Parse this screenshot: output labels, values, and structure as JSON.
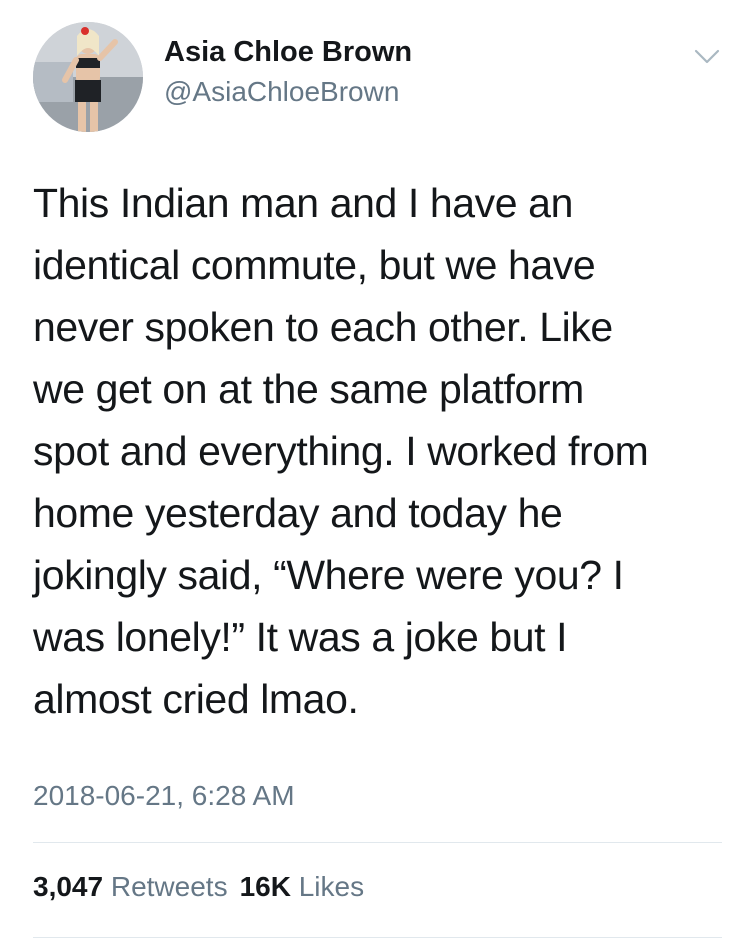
{
  "author": {
    "name": "Asia Chloe Brown",
    "handle": "@AsiaChloeBrown",
    "avatar_icon": "profile-photo"
  },
  "menu": {
    "icon": "chevron-down-icon"
  },
  "tweet": {
    "lines": [
      "This Indian man and I have an",
      "identical commute, but we have",
      "never spoken to each other. Like",
      "we get on at the same platform",
      "spot and everything. I worked from",
      "home yesterday and today he",
      "jokingly said, “Where were you? I",
      "was lonely!” It was a joke but I",
      "almost cried lmao."
    ],
    "timestamp": "2018-06-21, 6:28 AM"
  },
  "stats": {
    "retweets_count": "3,047",
    "retweets_label": "Retweets",
    "likes_count": "16K",
    "likes_label": "Likes"
  },
  "colors": {
    "text": "#14171a",
    "secondary": "#657786",
    "divider": "#e1e8ed"
  }
}
